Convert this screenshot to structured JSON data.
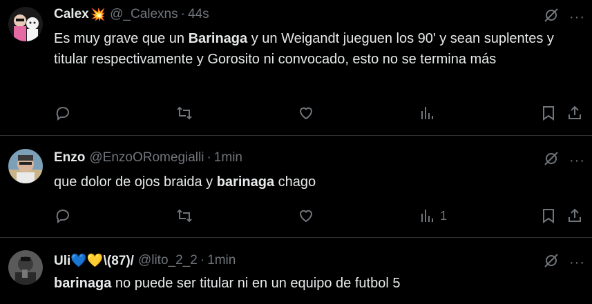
{
  "tweets": [
    {
      "name": "Calex",
      "name_emoji": "💥",
      "handle": "@_Calexns",
      "time": "44s",
      "text_segments": [
        {
          "t": "Es muy grave que un ",
          "b": false
        },
        {
          "t": "Barinaga",
          "b": true
        },
        {
          "t": " y un Weigandt jueguen los 90' y sean suplentes y titular respectivamente y Gorosito ni convocado, esto no se termina más",
          "b": false
        }
      ],
      "views": ""
    },
    {
      "name": "Enzo",
      "name_emoji": "",
      "handle": "@EnzoORomegialli",
      "time": "1min",
      "text_segments": [
        {
          "t": "que dolor de ojos braida y ",
          "b": false
        },
        {
          "t": "barinaga",
          "b": true
        },
        {
          "t": " chago",
          "b": false
        }
      ],
      "views": "1"
    },
    {
      "name": "Uli💙💛\\(87)/",
      "name_emoji": "",
      "handle": "@lito_2_2",
      "time": "1min",
      "text_segments": [
        {
          "t": "barinaga",
          "b": true
        },
        {
          "t": " no puede ser titular ni en un equipo de futbol 5",
          "b": false
        }
      ],
      "views": ""
    }
  ],
  "separator": "·",
  "more_label": "···",
  "icons": [
    "grok-icon",
    "more-icon",
    "reply-icon",
    "retweet-icon",
    "like-icon",
    "views-icon",
    "bookmark-icon",
    "share-icon"
  ],
  "colors": {
    "background": "#000000",
    "text": "#e7e9ea",
    "muted": "#71767b",
    "border": "#2f3336"
  }
}
